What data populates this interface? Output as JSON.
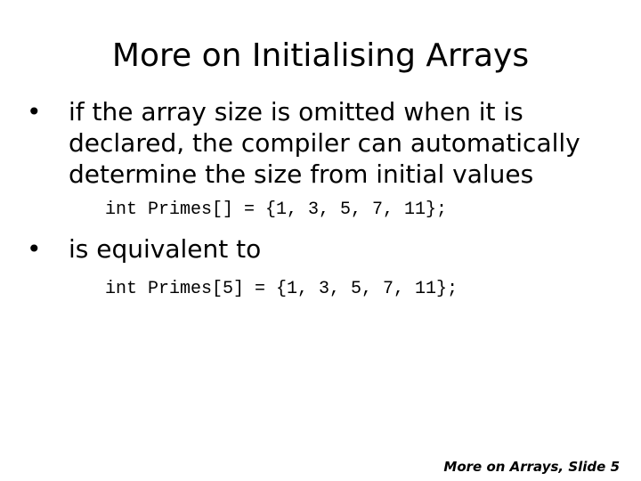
{
  "slide": {
    "title": "More on Initialising Arrays",
    "bullets": [
      {
        "marker": "•",
        "lines": [
          "if the array size is omitted when it is",
          "declared, the compiler can automatically",
          "determine the size from initial values"
        ]
      },
      {
        "marker": "•",
        "lines": [
          "is equivalent to"
        ]
      }
    ],
    "code": [
      "int Primes[] = {1, 3, 5, 7, 11};",
      "int Primes[5] = {1, 3, 5, 7, 11};"
    ],
    "footer": "More on Arrays, Slide 5"
  }
}
